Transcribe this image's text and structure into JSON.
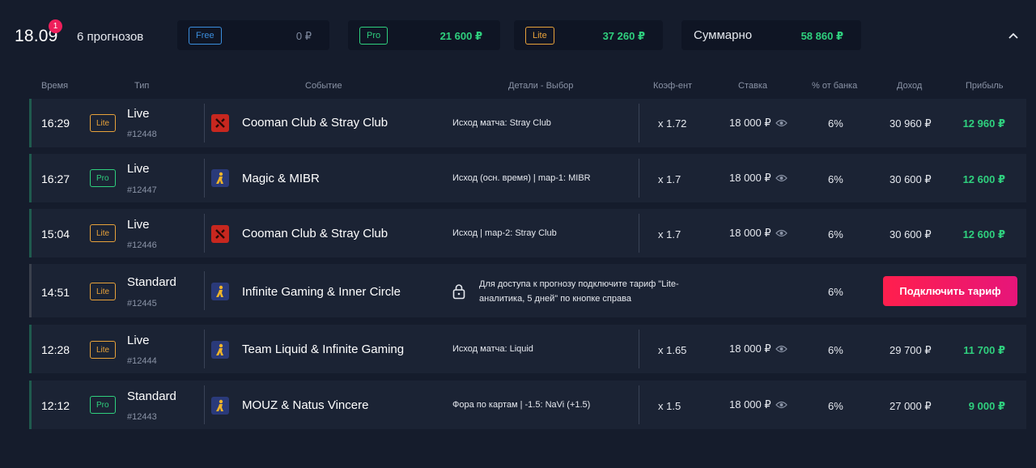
{
  "header": {
    "date": "18.09",
    "notification_count": "1",
    "forecast_count": "6 прогнозов",
    "cards": [
      {
        "tier": "Free",
        "amount": "0 ₽",
        "tier_color": "#3b8ede",
        "amount_color": "#7f8aa0"
      },
      {
        "tier": "Pro",
        "amount": "21 600 ₽",
        "tier_color": "#2fd07e",
        "amount_color": "#2fd07e"
      },
      {
        "tier": "Lite",
        "amount": "37 260 ₽",
        "tier_color": "#e8a23a",
        "amount_color": "#2fd07e"
      }
    ],
    "total": {
      "label": "Суммарно",
      "amount": "58 860 ₽"
    }
  },
  "columns": {
    "time": "Время",
    "type": "Тип",
    "event": "Событие",
    "details": "Детали - Выбор",
    "coef": "Коэф-ент",
    "stake": "Ставка",
    "bank_pct": "% от банка",
    "income": "Доход",
    "profit": "Прибыль"
  },
  "rows": [
    {
      "time": "16:29",
      "tier": "Lite",
      "type": "Live",
      "id": "#12448",
      "game": "dota2-icon",
      "event": "Cooman Club & Stray Club",
      "details": "Исход матча: Stray Club",
      "coef": "x 1.72",
      "stake": "18 000 ₽",
      "pct": "6%",
      "income": "30 960 ₽",
      "profit": "12 960 ₽"
    },
    {
      "time": "16:27",
      "tier": "Pro",
      "type": "Live",
      "id": "#12447",
      "game": "csgo-icon",
      "event": "Magic & MIBR",
      "details": "Исход (осн. время) | map-1: MIBR",
      "coef": "x 1.7",
      "stake": "18 000 ₽",
      "pct": "6%",
      "income": "30 600 ₽",
      "profit": "12 600 ₽"
    },
    {
      "time": "15:04",
      "tier": "Lite",
      "type": "Live",
      "id": "#12446",
      "game": "dota2-icon",
      "event": "Cooman Club & Stray Club",
      "details": "Исход | map-2: Stray Club",
      "coef": "x 1.7",
      "stake": "18 000 ₽",
      "pct": "6%",
      "income": "30 600 ₽",
      "profit": "12 600 ₽"
    },
    {
      "time": "14:51",
      "tier": "Lite",
      "type": "Standard",
      "id": "#12445",
      "game": "csgo-icon",
      "event": "Infinite Gaming & Inner Circle",
      "locked_text": "Для доступа к прогнозу подключите тариф \"Lite-аналитика, 5 дней\" по кнопке справа",
      "pct": "6%",
      "button": "Подключить тариф"
    },
    {
      "time": "12:28",
      "tier": "Lite",
      "type": "Live",
      "id": "#12444",
      "game": "csgo-icon",
      "event": "Team Liquid & Infinite Gaming",
      "details": "Исход матча: Liquid",
      "coef": "x 1.65",
      "stake": "18 000 ₽",
      "pct": "6%",
      "income": "29 700 ₽",
      "profit": "11 700 ₽"
    },
    {
      "time": "12:12",
      "tier": "Pro",
      "type": "Standard",
      "id": "#12443",
      "game": "csgo-icon",
      "event": "MOUZ & Natus Vincere",
      "details": "Фора по картам | -1.5: NaVi (+1.5)",
      "coef": "x 1.5",
      "stake": "18 000 ₽",
      "pct": "6%",
      "income": "27 000 ₽",
      "profit": "9 000 ₽"
    }
  ],
  "colors": {
    "lite": "#e8a23a",
    "pro": "#2fd07e",
    "free": "#3b8ede",
    "profit": "#2fd07e",
    "accent_button": "#ff1f4d"
  }
}
